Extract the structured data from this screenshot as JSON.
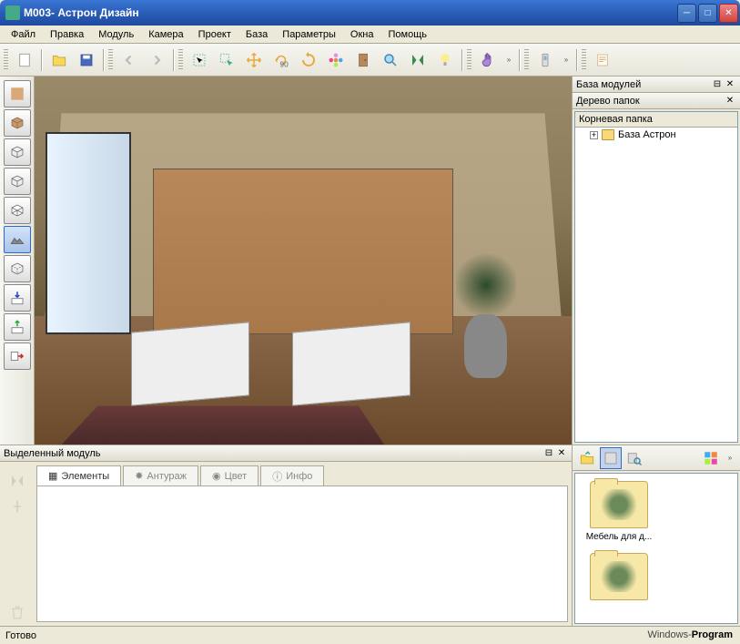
{
  "window": {
    "title": "М003- Астрон Дизайн"
  },
  "menu": [
    "Файл",
    "Правка",
    "Модуль",
    "Камера",
    "Проект",
    "База",
    "Параметры",
    "Окна",
    "Помощь"
  ],
  "toolbar_icons": [
    "new-file",
    "open-file",
    "save-file",
    "undo",
    "redo",
    "select-rect",
    "select-arrow",
    "move",
    "rotate-90",
    "rotate",
    "flower",
    "door",
    "magnify",
    "mirror",
    "lightbulb",
    "hand",
    "phone",
    "notes"
  ],
  "left_tools": [
    "texture",
    "box-solid",
    "box-wireframe",
    "box-outline",
    "box-perspective",
    "terrain",
    "box-hidden",
    "import-down",
    "export-up",
    "export-right"
  ],
  "right_panel": {
    "title": "База модулей",
    "tree_title": "Дерево папок",
    "root_label": "Корневая папка",
    "items": [
      {
        "label": "База Астрон"
      }
    ]
  },
  "module_panel": {
    "title": "Выделенный модуль",
    "tabs": [
      "Элементы",
      "Антураж",
      "Цвет",
      "Инфо"
    ]
  },
  "thumb_panel": {
    "items": [
      {
        "label": "Мебель для д..."
      },
      {
        "label": ""
      }
    ]
  },
  "status": "Готово",
  "watermark": {
    "a": "Windows-",
    "b": "Program"
  }
}
